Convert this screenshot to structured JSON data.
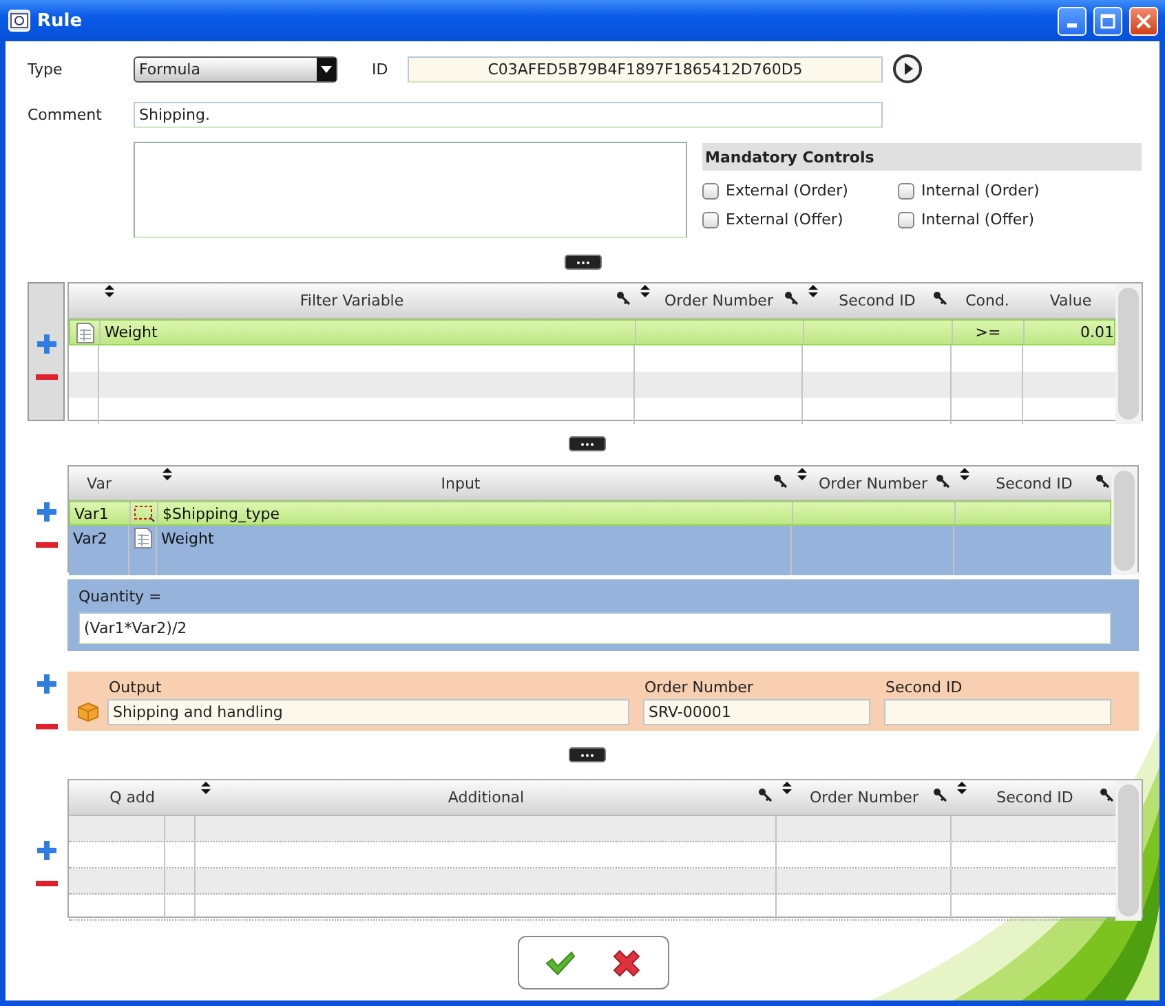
{
  "window": {
    "title": "Rule"
  },
  "type_field": {
    "label": "Type",
    "value": "Formula"
  },
  "id_field": {
    "label": "ID",
    "value": "C03AFED5B79B4F1897F1865412D760D5"
  },
  "comment_field": {
    "label": "Comment",
    "value": "Shipping."
  },
  "mandatory_controls": {
    "title": "Mandatory Controls",
    "options": [
      {
        "label": "External (Order)",
        "checked": false
      },
      {
        "label": "Internal (Order)",
        "checked": false
      },
      {
        "label": "External (Offer)",
        "checked": false
      },
      {
        "label": "Internal (Offer)",
        "checked": false
      }
    ]
  },
  "filter_table": {
    "columns": [
      {
        "label": "Filter Variable",
        "sortable": true,
        "keyed": true
      },
      {
        "label": "Order Number",
        "sortable": true,
        "keyed": true
      },
      {
        "label": "Second ID",
        "sortable": true,
        "keyed": true
      },
      {
        "label": "Cond.",
        "sortable": false,
        "keyed": false
      },
      {
        "label": "Value",
        "sortable": false,
        "keyed": false
      }
    ],
    "rows": [
      {
        "kind": "field",
        "cells": [
          "Weight",
          null,
          null,
          ">=",
          "0.01"
        ],
        "selected": true,
        "highlighted": false
      }
    ]
  },
  "input_table": {
    "columns": [
      {
        "label": "Var",
        "sortable": false,
        "keyed": false
      },
      {
        "label": "Input",
        "sortable": true,
        "keyed": true
      },
      {
        "label": "Order Number",
        "sortable": true,
        "keyed": true
      },
      {
        "label": "Second ID",
        "sortable": true,
        "keyed": true
      }
    ],
    "rows": [
      {
        "kind": "selection",
        "cells": [
          "Var1",
          "$Shipping_type",
          null,
          null
        ],
        "selected": true,
        "highlighted": false
      },
      {
        "kind": "field",
        "cells": [
          "Var2",
          "Weight",
          null,
          null
        ],
        "selected": false,
        "highlighted": true
      }
    ]
  },
  "formula": {
    "label": "Quantity =",
    "value": "(Var1*Var2)/2"
  },
  "output": {
    "fields": [
      {
        "label": "Output",
        "value": "Shipping and handling"
      },
      {
        "label": "Order Number",
        "value": "SRV-00001"
      },
      {
        "label": "Second ID"
      }
    ]
  },
  "additional_table": {
    "columns": [
      {
        "label": "Q add",
        "sortable": false,
        "keyed": false
      },
      {
        "label": "Additional",
        "sortable": true,
        "keyed": true
      },
      {
        "label": "Order Number",
        "sortable": true,
        "keyed": true
      },
      {
        "label": "Second ID",
        "sortable": true,
        "keyed": true
      }
    ]
  }
}
